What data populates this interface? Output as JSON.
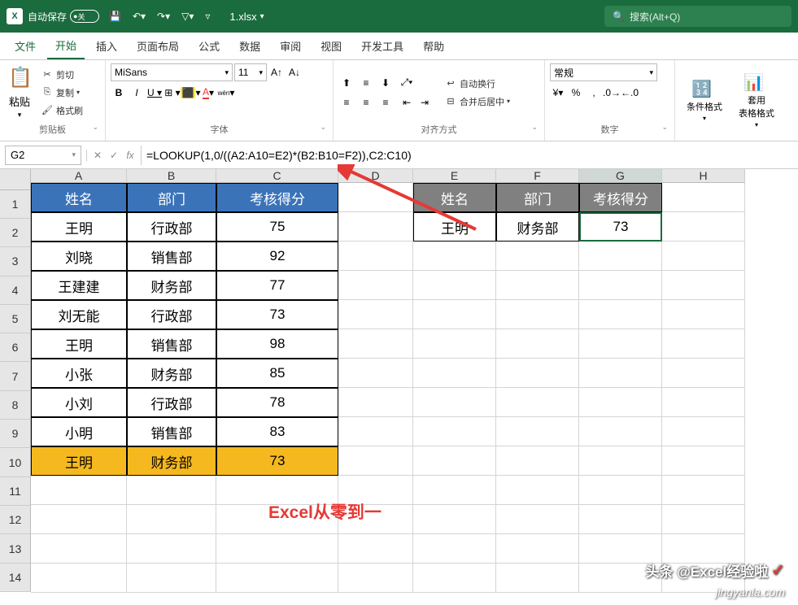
{
  "titlebar": {
    "autosave_label": "自动保存",
    "autosave_state": "关",
    "filename": "1.xlsx",
    "search_placeholder": "搜索(Alt+Q)"
  },
  "menu": {
    "file": "文件",
    "home": "开始",
    "insert": "插入",
    "pagelayout": "页面布局",
    "formulas": "公式",
    "data": "数据",
    "review": "审阅",
    "view": "视图",
    "devtools": "开发工具",
    "help": "帮助"
  },
  "ribbon": {
    "paste": "粘贴",
    "cut": "剪切",
    "copy": "复制",
    "formatpainter": "格式刷",
    "clipboard_group": "剪贴板",
    "font_name": "MiSans",
    "font_size": "11",
    "font_group": "字体",
    "wrap": "自动换行",
    "merge": "合并后居中",
    "align_group": "对齐方式",
    "number_format": "常规",
    "number_group": "数字",
    "cond_format": "条件格式",
    "table_format": "套用\n表格格式"
  },
  "formulabar": {
    "cellref": "G2",
    "formula": "=LOOKUP(1,0/((A2:A10=E2)*(B2:B10=F2)),C2:C10)"
  },
  "columns": [
    "A",
    "B",
    "C",
    "D",
    "E",
    "F",
    "G",
    "H"
  ],
  "rownums": [
    "1",
    "2",
    "3",
    "4",
    "5",
    "6",
    "7",
    "8",
    "9",
    "10",
    "11",
    "12",
    "13",
    "14"
  ],
  "table1": {
    "headers": [
      "姓名",
      "部门",
      "考核得分"
    ],
    "rows": [
      [
        "王明",
        "行政部",
        "75"
      ],
      [
        "刘晓",
        "销售部",
        "92"
      ],
      [
        "王建建",
        "财务部",
        "77"
      ],
      [
        "刘无能",
        "行政部",
        "73"
      ],
      [
        "王明",
        "销售部",
        "98"
      ],
      [
        "小张",
        "财务部",
        "85"
      ],
      [
        "小刘",
        "行政部",
        "78"
      ],
      [
        "小明",
        "销售部",
        "83"
      ],
      [
        "王明",
        "财务部",
        "73"
      ]
    ]
  },
  "table2": {
    "headers": [
      "姓名",
      "部门",
      "考核得分"
    ],
    "rows": [
      [
        "王明",
        "财务部",
        "73"
      ]
    ]
  },
  "annotation": "Excel从零到一",
  "watermark1": "头条 @Excel经验啦",
  "watermark2": "jingyanla.com"
}
